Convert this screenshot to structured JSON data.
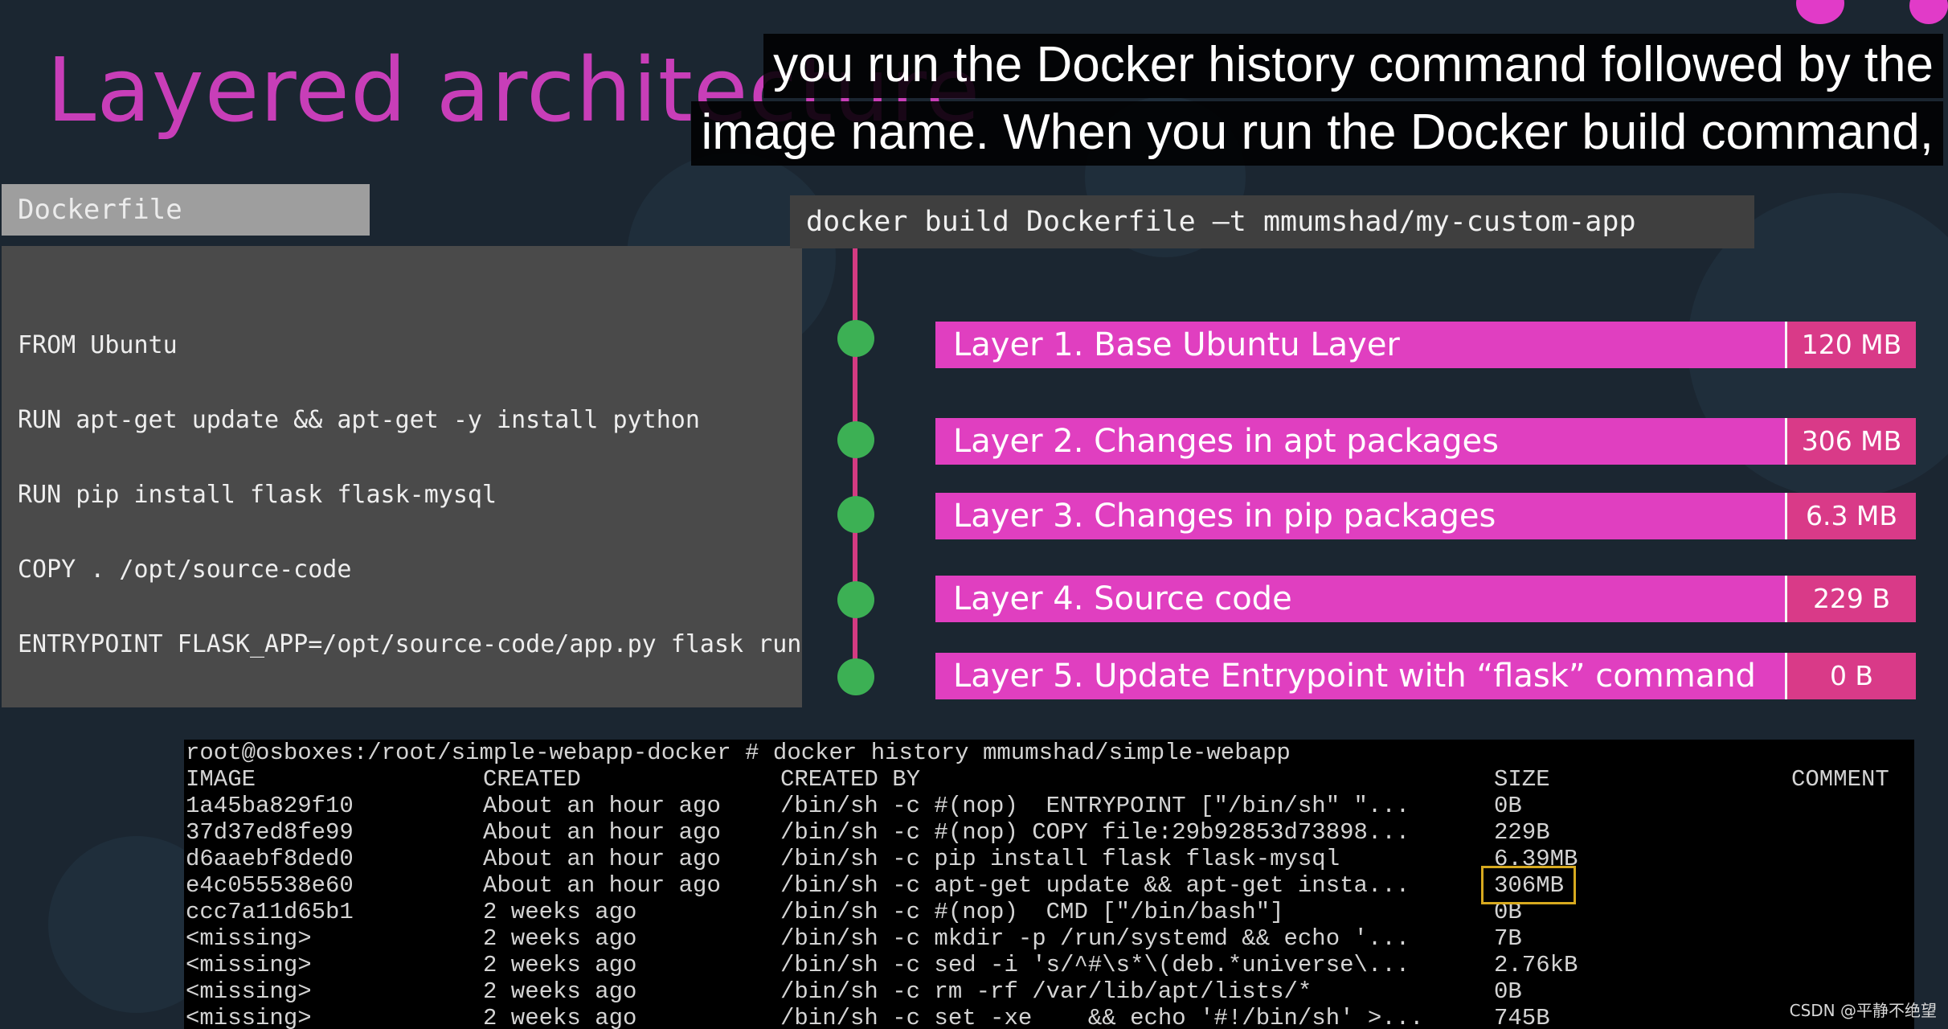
{
  "slide": {
    "title": "Layered architecture"
  },
  "subtitles": [
    "you run the Docker history command followed by the",
    "image name. When you run the Docker build command,"
  ],
  "dockerfile": {
    "header": "Dockerfile",
    "lines": [
      "FROM Ubuntu",
      "RUN apt-get update && apt-get -y install python",
      "RUN pip install flask flask-mysql",
      "COPY . /opt/source-code",
      "ENTRYPOINT FLASK_APP=/opt/source-code/app.py flask run"
    ]
  },
  "build_command": "docker build Dockerfile –t mmumshad/my-custom-app",
  "layers": [
    {
      "label": "Layer 1. Base Ubuntu Layer",
      "size": "120 MB"
    },
    {
      "label": "Layer 2. Changes in apt packages",
      "size": "306 MB"
    },
    {
      "label": "Layer 3. Changes in pip packages",
      "size": "6.3 MB"
    },
    {
      "label": "Layer 4. Source code",
      "size": "229 B"
    },
    {
      "label": "Layer 5. Update Entrypoint with “flask” command",
      "size": "0 B"
    }
  ],
  "terminal": {
    "prompt": "root@osboxes:/root/simple-webapp-docker # docker history mmumshad/simple-webapp",
    "headers": {
      "image": "IMAGE",
      "created": "CREATED",
      "created_by": "CREATED BY",
      "size": "SIZE",
      "comment": "COMMENT"
    },
    "rows": [
      {
        "image": "1a45ba829f10",
        "created": "About an hour ago",
        "created_by": "/bin/sh -c #(nop)  ENTRYPOINT [\"/bin/sh\" \"...",
        "size": "0B"
      },
      {
        "image": "37d37ed8fe99",
        "created": "About an hour ago",
        "created_by": "/bin/sh -c #(nop) COPY file:29b92853d73898...",
        "size": "229B"
      },
      {
        "image": "d6aaebf8ded0",
        "created": "About an hour ago",
        "created_by": "/bin/sh -c pip install flask flask-mysql",
        "size": "6.39MB"
      },
      {
        "image": "e4c055538e60",
        "created": "About an hour ago",
        "created_by": "/bin/sh -c apt-get update && apt-get insta...",
        "size": "306MB"
      },
      {
        "image": "ccc7a11d65b1",
        "created": "2 weeks ago",
        "created_by": "/bin/sh -c #(nop)  CMD [\"/bin/bash\"]",
        "size": "0B"
      },
      {
        "image": "<missing>",
        "created": "2 weeks ago",
        "created_by": "/bin/sh -c mkdir -p /run/systemd && echo '...",
        "size": "7B"
      },
      {
        "image": "<missing>",
        "created": "2 weeks ago",
        "created_by": "/bin/sh -c sed -i 's/^#\\s*\\(deb.*universe\\...",
        "size": "2.76kB"
      },
      {
        "image": "<missing>",
        "created": "2 weeks ago",
        "created_by": "/bin/sh -c rm -rf /var/lib/apt/lists/*",
        "size": "0B"
      },
      {
        "image": "<missing>",
        "created": "2 weeks ago",
        "created_by": "/bin/sh -c set -xe    && echo '#!/bin/sh' >...",
        "size": "745B"
      }
    ]
  },
  "watermark": "CSDN @平静不绝望",
  "colors": {
    "background": "#1b2631",
    "title_pink": "#c83eb8",
    "layer_pink": "#e03fc0",
    "size_pink": "#d93a88",
    "node_green": "#3cb054",
    "highlight": "#d7a91f"
  }
}
